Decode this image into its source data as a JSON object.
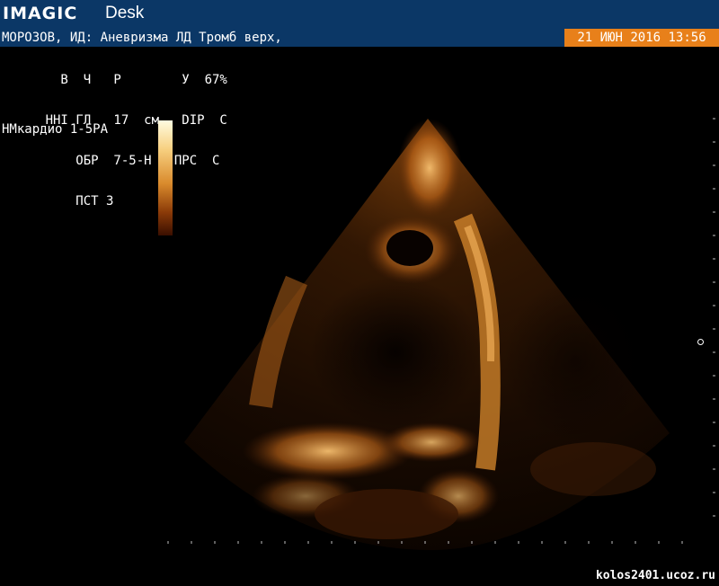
{
  "titlebar": {
    "brand": "IMAGIC",
    "product": "Desk"
  },
  "patient": {
    "line": "МОРОЗОВ, ИД: Аневризма ЛД Тромб верх,",
    "datetime": "21 ИЮН 2016 13:56"
  },
  "params": {
    "row1": "        В  Ч   Р        У  67%",
    "row2": "      ННI ГЛ   17  см   DIP  С",
    "row3": "          ОБР  7-5-Н   ПРС  С",
    "row4": "          ПСТ 3"
  },
  "preset": "НМкардио 1-5РА",
  "colors": {
    "titlebar": "#0b3766",
    "datetime_bg": "#e8801a",
    "echo": "#d98a2c"
  },
  "watermark": "kolos2401.ucoz.ru"
}
